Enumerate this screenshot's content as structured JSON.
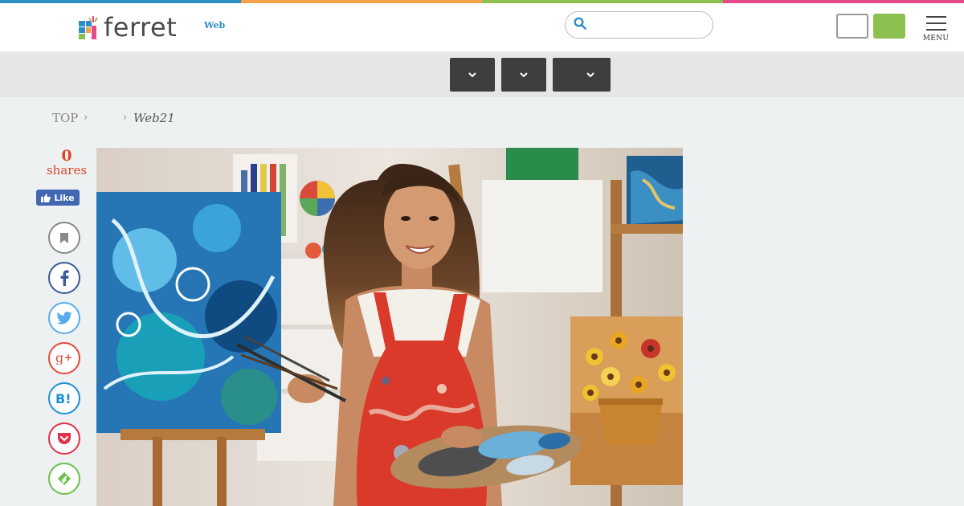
{
  "header": {
    "color_bar": [
      "#2c8ec7",
      "#f4a24a",
      "#8cc152",
      "#e6488a"
    ],
    "logo_text": "ferret",
    "logo_sub": "Web",
    "search_placeholder": "",
    "menu_label": "MENU",
    "accent_green": "#8cc152"
  },
  "subnav": {
    "dropdowns": [
      "",
      "",
      ""
    ]
  },
  "breadcrumb": {
    "top": "TOP",
    "sep": "›",
    "current": "Web21"
  },
  "social": {
    "share_count": "0",
    "share_label": "shares",
    "like_label": "Like",
    "buttons": [
      {
        "name": "bookmark-icon",
        "color": "#888888"
      },
      {
        "name": "facebook-icon",
        "color": "#3b5998"
      },
      {
        "name": "twitter-icon",
        "color": "#55acee"
      },
      {
        "name": "google-plus-icon",
        "color": "#dd4b39"
      },
      {
        "name": "hatena-bookmark-icon",
        "color": "#1e90d6"
      },
      {
        "name": "pocket-icon",
        "color": "#e0324b"
      },
      {
        "name": "feedly-icon",
        "color": "#6cc04a"
      }
    ]
  },
  "hero_image": {
    "subject": "artist-with-palette-in-studio"
  }
}
